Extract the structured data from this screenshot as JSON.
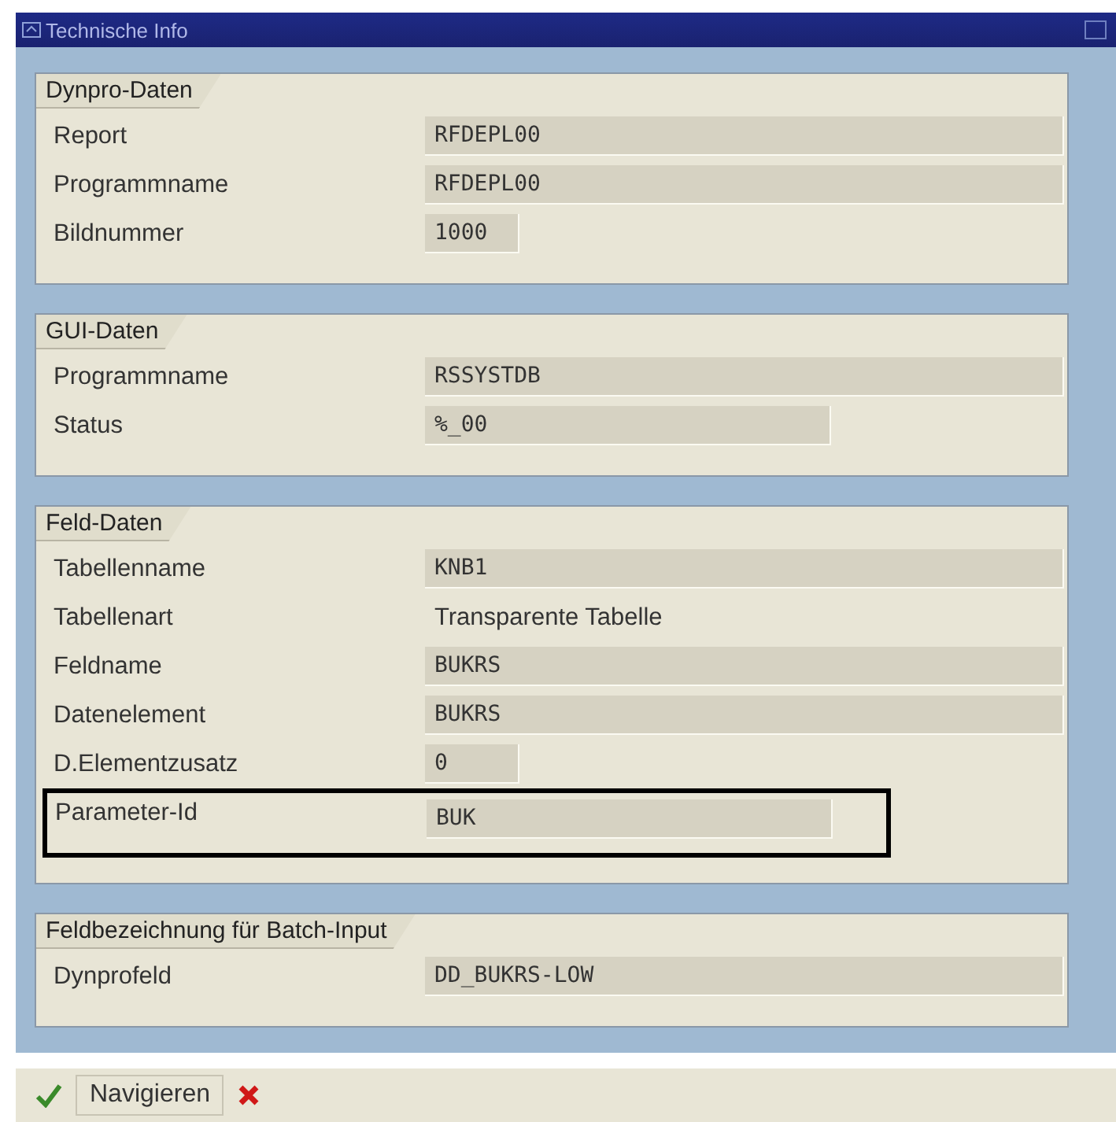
{
  "window": {
    "title": "Technische Info"
  },
  "groups": [
    {
      "title": "Dynpro-Daten",
      "fields": [
        {
          "label": "Report",
          "value": "RFDEPL00",
          "kind": "long",
          "highlighted": false
        },
        {
          "label": "Programmname",
          "value": "RFDEPL00",
          "kind": "long",
          "highlighted": false
        },
        {
          "label": "Bildnummer",
          "value": "1000",
          "kind": "short",
          "highlighted": false
        }
      ]
    },
    {
      "title": "GUI-Daten",
      "fields": [
        {
          "label": "Programmname",
          "value": "RSSYSTDB",
          "kind": "long",
          "highlighted": false
        },
        {
          "label": "Status",
          "value": "%_00",
          "kind": "medium",
          "highlighted": false
        }
      ]
    },
    {
      "title": "Feld-Daten",
      "fields": [
        {
          "label": "Tabellenname",
          "value": "KNB1",
          "kind": "long",
          "highlighted": false
        },
        {
          "label": "Tabellenart",
          "value": "Transparente Tabelle",
          "kind": "text",
          "highlighted": false
        },
        {
          "label": "Feldname",
          "value": "BUKRS",
          "kind": "long",
          "highlighted": false
        },
        {
          "label": "Datenelement",
          "value": "BUKRS",
          "kind": "long",
          "highlighted": false
        },
        {
          "label": "D.Elementzusatz",
          "value": "0",
          "kind": "short",
          "highlighted": false
        },
        {
          "label": "Parameter-Id",
          "value": "BUK",
          "kind": "medium",
          "highlighted": true
        }
      ]
    },
    {
      "title": "Feldbezeichnung für Batch-Input",
      "fields": [
        {
          "label": "Dynprofeld",
          "value": "DD_BUKRS-LOW",
          "kind": "long",
          "highlighted": false
        }
      ]
    }
  ],
  "toolbar": {
    "button": "Navigieren"
  }
}
